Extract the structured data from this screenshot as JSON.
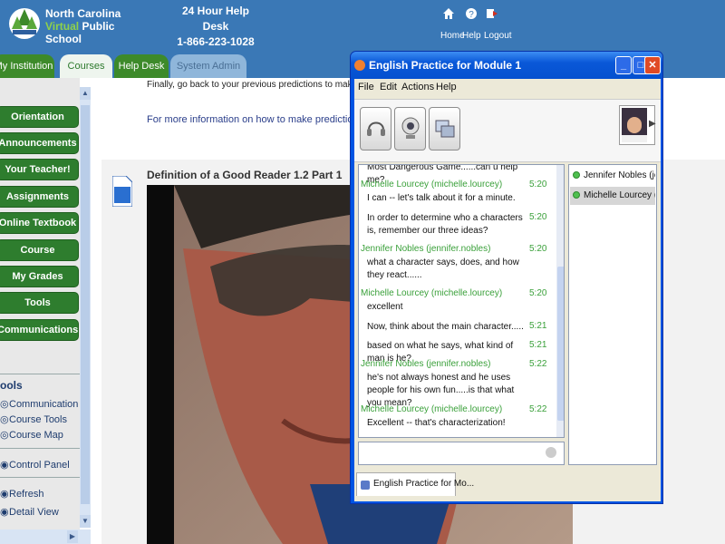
{
  "header": {
    "logo": {
      "line1": "North Carolina",
      "line2_green": "Virtual",
      "line2_rest": "Public School"
    },
    "helpdesk": {
      "title": "24 Hour Help Desk",
      "phone": "1-866-223-1028"
    },
    "top_nav": [
      {
        "label": "Home",
        "icon": "home-icon"
      },
      {
        "label": "Help",
        "icon": "help-icon"
      },
      {
        "label": "Logout",
        "icon": "logout-icon"
      }
    ],
    "tabs": [
      "My Institution",
      "Courses",
      "Help Desk",
      "System Admin"
    ]
  },
  "sidebar": {
    "buttons": [
      "Orientation",
      "Announcements",
      "Your Teacher!",
      "Assignments",
      "Online Textbook",
      "Course Documents",
      "My Grades",
      "Tools",
      "Communications"
    ],
    "tools_heading": "ools",
    "tool_links": [
      "Communication",
      "Course Tools",
      "Course Map"
    ],
    "control_panel": "Control Panel",
    "refresh": "Refresh",
    "detail_view": "Detail View"
  },
  "main": {
    "cut_text": "Finally, go back to your previous predictions to make",
    "more_info": "For more information on how to make predictions, refe",
    "video_title": "Definition of a Good Reader 1.2 Part 1"
  },
  "chat": {
    "title": "English Practice for Module 1",
    "menu": [
      "File",
      "Edit",
      "Actions",
      "Help"
    ],
    "messages": [
      {
        "text": "Most Dangerous Game......can u help me?"
      },
      {
        "sender": "Michelle Lourcey (michelle.lourcey)",
        "time": "5:20",
        "text": "I can -- let's talk about it for a minute."
      },
      {
        "time": "5:20",
        "text": "In order to determine who a characters is, remember our three ideas?"
      },
      {
        "sender": "Jennifer Nobles (jennifer.nobles)",
        "time": "5:20",
        "text": "what a character says, does, and how they react......"
      },
      {
        "sender": "Michelle Lourcey (michelle.lourcey)",
        "time": "5:20",
        "text": "excellent"
      },
      {
        "time": "5:21",
        "text": "Now, think about the main character....."
      },
      {
        "time": "5:21",
        "text": "based on what he says, what kind of man is he?"
      },
      {
        "sender": "Jennifer Nobles (jennifer.nobles)",
        "time": "5:22",
        "text": "he's not always honest and he uses people for his own fun.....is that what you mean?"
      },
      {
        "sender": "Michelle Lourcey (michelle.lourcey)",
        "time": "5:22",
        "text": "Excellent -- that's characterization!"
      }
    ],
    "participants": [
      "Jennifer Nobles (jen...",
      "Michelle Lourcey (mi..."
    ],
    "bottom_tab": "English Practice for Mo...",
    "colors": {
      "sender": "#3aa03a",
      "titlebar": "#0a58d8"
    }
  }
}
